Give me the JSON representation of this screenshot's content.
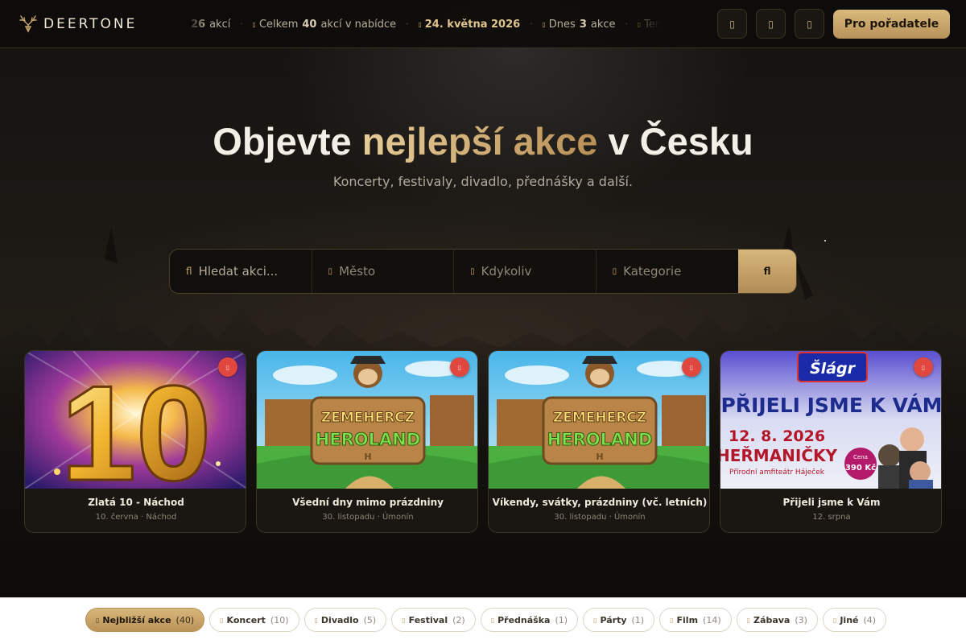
{
  "brand": {
    "logo_text": "DEERTONE"
  },
  "ticker": {
    "events_count": "26",
    "events_suffix": "akcí",
    "total_prefix": "Celkem",
    "total_count": "40",
    "total_suffix": "akcí v nabídce",
    "date": "24. května 2026",
    "today_prefix": "Dnes",
    "today_count": "3",
    "today_suffix": "akce",
    "week_text": "Tento týden"
  },
  "header": {
    "icon_buttons": [
      "search-icon",
      "user-icon",
      "menu-icon"
    ],
    "organizer_button": "Pro pořadatele"
  },
  "hero": {
    "title_before": "Objevte",
    "title_accent": "nejlepší akce",
    "title_after": "v Česku",
    "subtitle": "Koncerty, festivaly, divadlo, přednášky a další."
  },
  "search": {
    "query_placeholder": "Hledat akci...",
    "city_placeholder": "Město",
    "date_placeholder": "Kdykoliv",
    "category_placeholder": "Kategorie",
    "submit_icon": "search-icon"
  },
  "cards": [
    {
      "title": "Zlatá 10 - Náchod",
      "meta": "10. června · Náchod",
      "image": "golden-10-number"
    },
    {
      "title": "Všední dny mimo prázdniny",
      "meta": "30. listopadu · Úmonín",
      "image": "zemehercz-heroland"
    },
    {
      "title": "Víkendy, svátky, prázdniny (vč. letních)",
      "meta": "30. listopadu · Úmonín",
      "image": "zemehercz-heroland"
    },
    {
      "title": "Přijeli jsme k Vám",
      "meta": "12. srpna",
      "image": "slagr-poster",
      "poster": {
        "brand": "Šlágr",
        "headline": "PŘIJELI JSME K VÁM",
        "date": "12. 8. 2026",
        "place": "HEŘMANIČKY",
        "venue": "Přírodní amfiteátr Háječek",
        "price_label": "Cena",
        "price": "390 Kč"
      }
    }
  ],
  "heroland_sign": {
    "top": "ZEMEHERCZ",
    "bottom": "HEROLAND",
    "mark": "H"
  },
  "categories": [
    {
      "label": "Nejbližší akce",
      "count": "(40)",
      "active": true
    },
    {
      "label": "Koncert",
      "count": "(10)"
    },
    {
      "label": "Divadlo",
      "count": "(5)"
    },
    {
      "label": "Festival",
      "count": "(2)"
    },
    {
      "label": "Přednáška",
      "count": "(1)"
    },
    {
      "label": "Párty",
      "count": "(1)"
    },
    {
      "label": "Film",
      "count": "(14)"
    },
    {
      "label": "Zábava",
      "count": "(3)"
    },
    {
      "label": "Jiné",
      "count": "(4)"
    }
  ],
  "colors": {
    "accent_gold": "#c9a66b",
    "favorite_red": "#e0473f",
    "background": "#0e0c0a"
  }
}
